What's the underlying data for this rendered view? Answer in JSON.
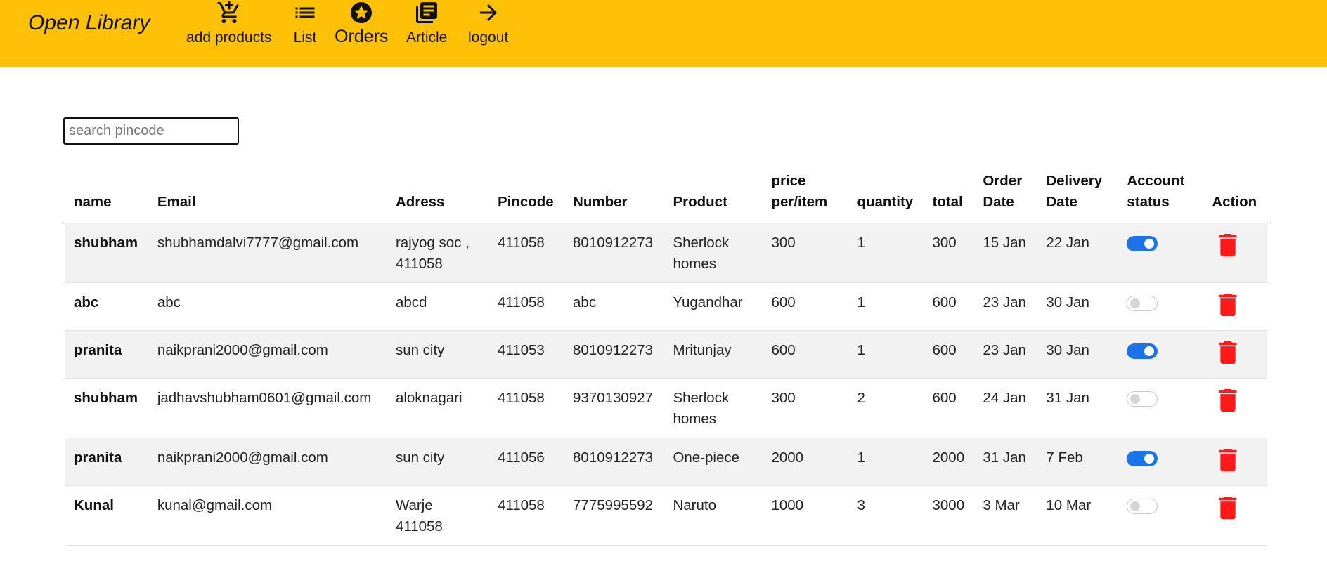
{
  "brand": "Open Library",
  "nav": [
    {
      "label": "add products",
      "icon": "add-cart-icon"
    },
    {
      "label": "List",
      "icon": "list-icon"
    },
    {
      "label": "Orders",
      "icon": "star-circle-icon"
    },
    {
      "label": "Article",
      "icon": "article-icon"
    },
    {
      "label": "logout",
      "icon": "arrow-right-icon"
    }
  ],
  "search": {
    "placeholder": "search pincode",
    "value": ""
  },
  "table": {
    "headers": {
      "name": "name",
      "email": "Email",
      "address": "Adress",
      "pincode": "Pincode",
      "number": "Number",
      "product": "Product",
      "price": "price per/item",
      "quantity": "quantity",
      "total": "total",
      "order_date": "Order Date",
      "delivery_date": "Delivery Date",
      "account_status": "Account status",
      "action": "Action"
    },
    "rows": [
      {
        "name": "shubham",
        "email": "shubhamdalvi7777@gmail.com",
        "address": "rajyog soc , 411058",
        "pincode": "411058",
        "number": "8010912273",
        "product": "Sherlock homes",
        "price": "300",
        "quantity": "1",
        "total": "300",
        "order_date": "15 Jan",
        "delivery_date": "22 Jan",
        "status": "on"
      },
      {
        "name": "abc",
        "email": "abc",
        "address": "abcd",
        "pincode": "411058",
        "number": "abc",
        "product": "Yugandhar",
        "price": "600",
        "quantity": "1",
        "total": "600",
        "order_date": "23 Jan",
        "delivery_date": "30 Jan",
        "status": "off"
      },
      {
        "name": "pranita",
        "email": "naikprani2000@gmail.com",
        "address": "sun city",
        "pincode": "411053",
        "number": "8010912273",
        "product": "Mritunjay",
        "price": "600",
        "quantity": "1",
        "total": "600",
        "order_date": "23 Jan",
        "delivery_date": "30 Jan",
        "status": "on"
      },
      {
        "name": "shubham",
        "email": "jadhavshubham0601@gmail.com",
        "address": "aloknagari",
        "pincode": "411058",
        "number": "9370130927",
        "product": "Sherlock homes",
        "price": "300",
        "quantity": "2",
        "total": "600",
        "order_date": "24 Jan",
        "delivery_date": "31 Jan",
        "status": "off"
      },
      {
        "name": "pranita",
        "email": "naikprani2000@gmail.com",
        "address": "sun city",
        "pincode": "411056",
        "number": "8010912273",
        "product": "One-piece",
        "price": "2000",
        "quantity": "1",
        "total": "2000",
        "order_date": "31 Jan",
        "delivery_date": "7 Feb",
        "status": "on"
      },
      {
        "name": "Kunal",
        "email": "kunal@gmail.com",
        "address": "Warje 411058",
        "pincode": "411058",
        "number": "7775995592",
        "product": "Naruto",
        "price": "1000",
        "quantity": "3",
        "total": "3000",
        "order_date": "3 Mar",
        "delivery_date": "10 Mar",
        "status": "off"
      }
    ]
  },
  "colors": {
    "header_bg": "#FFC107",
    "toggle_on": "#1a73e8",
    "delete": "#ff1a1a",
    "row_alt": "#f2f2f2"
  }
}
